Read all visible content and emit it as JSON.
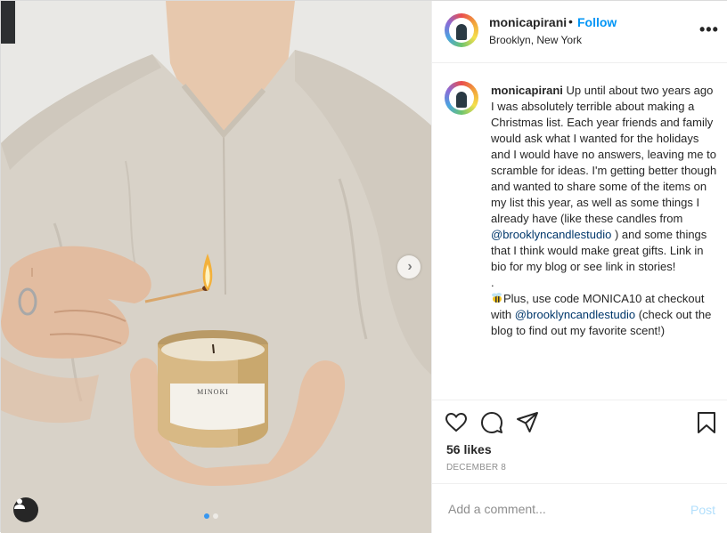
{
  "post": {
    "username": "monicapirani",
    "follow_label": "Follow",
    "separator": "•",
    "location": "Brooklyn, New York",
    "more_label": "•••",
    "candle_label": "MINOKI",
    "caption": {
      "username": "monicapirani",
      "text_1": " Up until about two years ago I was absolutely terrible about making a Christmas list. Each year friends and family would ask what I wanted for the holidays and I would have no answers, leaving me to scramble for ideas. I'm getting better though and wanted to share some of the items on my list this year, as well as some things I already have (like these candles from ",
      "mention_1": "@brooklyncandlestudio",
      "text_2": " ) and some things that I think would make great gifts. Link in bio for my blog or see link in stories!",
      "dot_line": ".",
      "text_3": "Plus, use code MONICA10 at checkout with ",
      "mention_2": "@brooklyncandlestudio",
      "text_4": " (check out the blog to find out my favorite scent!)"
    },
    "likes_label": "56 likes",
    "date_label": "DECEMBER 8",
    "comment_placeholder": "Add a comment...",
    "post_label": "Post",
    "carousel": {
      "slides": 2,
      "active_index": 0
    }
  },
  "icons": {
    "like": "heart-icon",
    "comment": "speech-bubble-icon",
    "share": "paper-plane-icon",
    "save": "bookmark-icon",
    "next": "chevron-right-icon",
    "tag": "user-tag-icon"
  },
  "colors": {
    "accent": "#0095f6",
    "mention": "#00376b",
    "post_disabled": "#b2dffc"
  }
}
